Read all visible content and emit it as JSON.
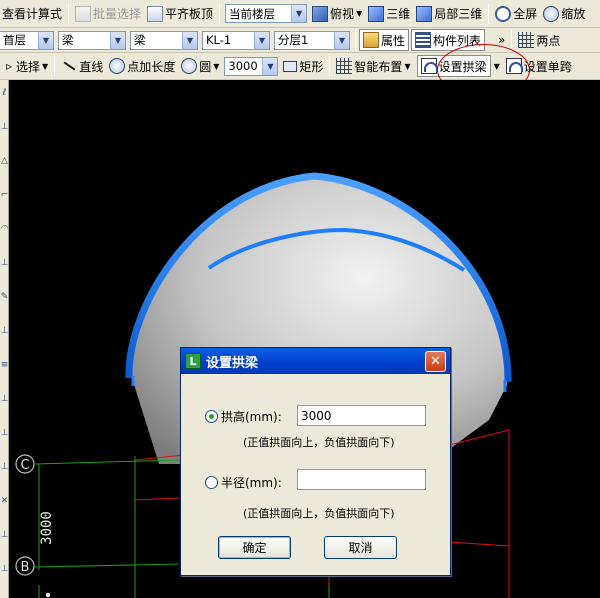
{
  "toolbar1": {
    "view_formula": "查看计算式",
    "batch_select": "批量选择",
    "align_top": "平齐板顶",
    "floor_select": "当前楼层",
    "top_view": "俯视",
    "three_d": "三维",
    "local_three_d": "局部三维",
    "fullscreen": "全屏",
    "zoom": "缩放"
  },
  "toolbar2": {
    "floor": "首层",
    "category": "梁",
    "type": "梁",
    "member": "KL-1",
    "layer": "分层1",
    "properties": "属性",
    "member_list": "构件列表",
    "more": "»",
    "two_point": "两点"
  },
  "toolbar3": {
    "select": "选择",
    "line": "直线",
    "point_length": "点加长度",
    "circle": "圆",
    "length_value": "3000",
    "rectangle": "矩形",
    "smart_layout": "智能布置",
    "set_arch_beam": "设置拱梁",
    "set_single": "设置单跨"
  },
  "left_strip": {
    "glyphs": [
      "ℓ",
      "⊥",
      "△",
      "⌐",
      "◠",
      "⊥",
      "✎",
      "⊥",
      "≡",
      "⊥",
      "⊥",
      "⊥",
      "✕",
      "⊥",
      "⊥"
    ]
  },
  "canvas": {
    "axis_c": "C",
    "axis_b": "B",
    "dimension": "3000",
    "colors": {
      "dome": "#bdbdbd",
      "arch_band": "#1e7dff",
      "grid_red": "#e01010",
      "grid_green": "#16a016"
    }
  },
  "dialog": {
    "title": "设置拱梁",
    "arch_height_label": "拱高(mm):",
    "arch_height_value": "3000",
    "arch_height_hint": "(正值拱面向上，负值拱面向下)",
    "radius_label": "半径(mm):",
    "radius_value": "",
    "radius_hint": "(正值拱面向上，负值拱面向下)",
    "ok": "确定",
    "cancel": "取消",
    "selected_option": "arch_height"
  },
  "annotation": {
    "highlight_color": "#d00000"
  }
}
